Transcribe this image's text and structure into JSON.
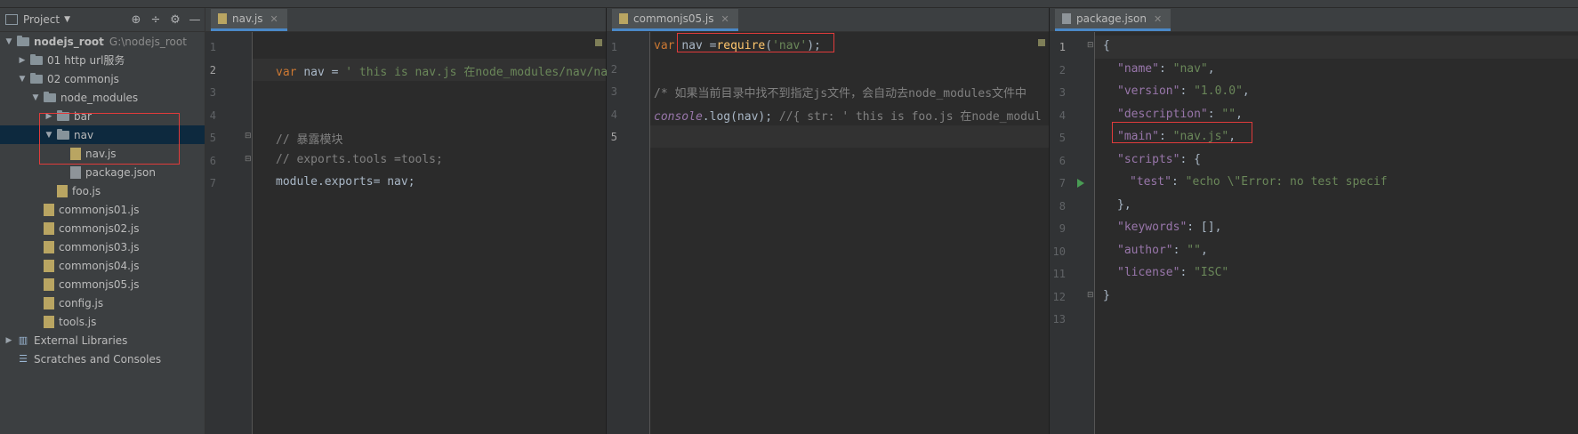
{
  "project": {
    "title": "Project",
    "tree": [
      {
        "label": "nodejs_root",
        "sub": "G:\\nodejs_root",
        "type": "folder",
        "arrow": "▼",
        "level": 0
      },
      {
        "label": "01 http url服务",
        "type": "folder",
        "arrow": "▶",
        "level": 1
      },
      {
        "label": "02 commonjs",
        "type": "folder",
        "arrow": "▼",
        "level": 1
      },
      {
        "label": "node_modules",
        "type": "folder",
        "arrow": "▼",
        "level": 2
      },
      {
        "label": "bar",
        "type": "folder",
        "arrow": "▶",
        "level": 3
      },
      {
        "label": "nav",
        "type": "folder",
        "arrow": "▼",
        "level": 3
      },
      {
        "label": "nav.js",
        "type": "js",
        "level": 4
      },
      {
        "label": "package.json",
        "type": "json",
        "level": 4
      },
      {
        "label": "foo.js",
        "type": "js",
        "level": 3
      },
      {
        "label": "commonjs01.js",
        "type": "js",
        "level": 2
      },
      {
        "label": "commonjs02.js",
        "type": "js",
        "level": 2
      },
      {
        "label": "commonjs03.js",
        "type": "js",
        "level": 2
      },
      {
        "label": "commonjs04.js",
        "type": "js",
        "level": 2
      },
      {
        "label": "commonjs05.js",
        "type": "js",
        "level": 2
      },
      {
        "label": "config.js",
        "type": "js",
        "level": 2
      },
      {
        "label": "tools.js",
        "type": "js",
        "level": 2
      },
      {
        "label": "External Libraries",
        "type": "lib",
        "arrow": "▶",
        "level": 0
      },
      {
        "label": "Scratches and Consoles",
        "type": "scratch",
        "level": 0
      }
    ]
  },
  "editors": [
    {
      "tab": "nav.js",
      "lines": [
        [],
        [
          [
            "kw",
            "var"
          ],
          [
            "",
            "nav = "
          ],
          [
            "str",
            "' this is nav.js 在node_modules/nav/nav.js'"
          ]
        ],
        [],
        [],
        [
          [
            "cmt",
            "// 暴露模块"
          ]
        ],
        [
          [
            "cmt",
            "// exports.tools =tools;"
          ]
        ],
        [
          [
            "",
            "module.exports= nav;"
          ]
        ]
      ]
    },
    {
      "tab": "commonjs05.js",
      "lines": [
        [
          [
            "kw",
            "var"
          ],
          [
            "",
            "nav ="
          ],
          [
            "fn",
            "require"
          ],
          [
            "",
            "("
          ],
          [
            "str",
            "'nav'"
          ],
          [
            "",
            ");"
          ]
        ],
        [],
        [
          [
            "cmt",
            "/* 如果当前目录中找不到指定js文件，会自动去node_modules文件中"
          ]
        ],
        [
          [
            "obj",
            "console"
          ],
          [
            "",
            ".log(nav); "
          ],
          [
            "cmt",
            "//{ str: ' this is foo.js 在node_modul"
          ]
        ],
        []
      ]
    },
    {
      "tab": "package.json",
      "lines": [
        [
          [
            "",
            "{"
          ]
        ],
        [
          [
            "key",
            "\"name\""
          ],
          [
            "",
            ": "
          ],
          [
            "str",
            "\"nav\""
          ],
          [
            "",
            ","
          ]
        ],
        [
          [
            "key",
            "\"version\""
          ],
          [
            "",
            ": "
          ],
          [
            "str",
            "\"1.0.0\""
          ],
          [
            "",
            ","
          ]
        ],
        [
          [
            "key",
            "\"description\""
          ],
          [
            "",
            ": "
          ],
          [
            "str",
            "\"\""
          ],
          [
            "",
            ","
          ]
        ],
        [
          [
            "key",
            "\"main\""
          ],
          [
            "",
            ": "
          ],
          [
            "str",
            "\"nav.js\""
          ],
          [
            "",
            ","
          ]
        ],
        [
          [
            "key",
            "\"scripts\""
          ],
          [
            "",
            ": {"
          ]
        ],
        [
          [
            "key",
            "\"test\""
          ],
          [
            "",
            ": "
          ],
          [
            "str",
            "\"echo \\\"Error: no test specif"
          ]
        ],
        [
          [
            "",
            "},"
          ]
        ],
        [
          [
            "key",
            "\"keywords\""
          ],
          [
            "",
            ": [],"
          ]
        ],
        [
          [
            "key",
            "\"author\""
          ],
          [
            "",
            ": "
          ],
          [
            "str",
            "\"\""
          ],
          [
            "",
            ","
          ]
        ],
        [
          [
            "key",
            "\"license\""
          ],
          [
            "",
            ": "
          ],
          [
            "str",
            "\"ISC\""
          ]
        ],
        [
          [
            "",
            "}"
          ]
        ],
        []
      ]
    }
  ],
  "colors": {
    "accent": "#4a88c7",
    "highlight_box": "#e03b3b"
  }
}
